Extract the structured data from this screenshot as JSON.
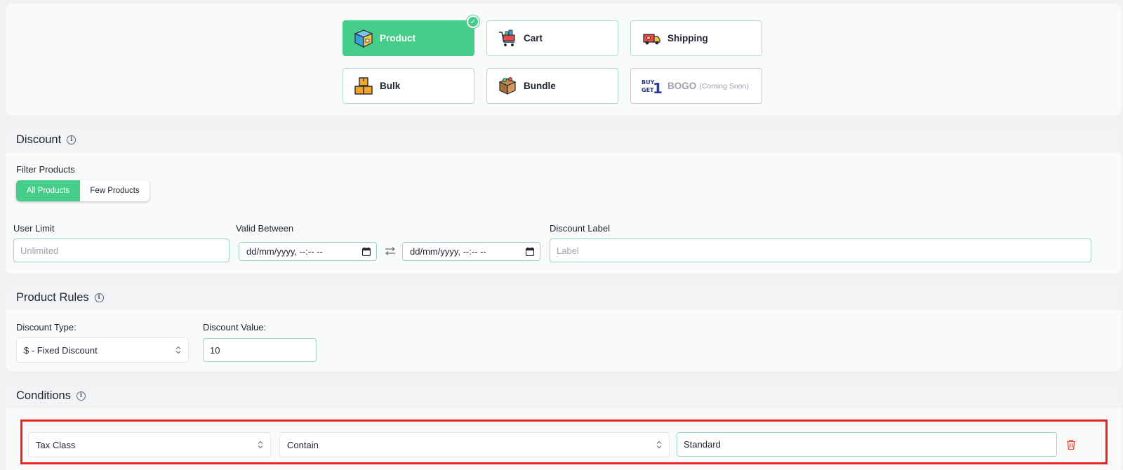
{
  "campaign_types": [
    {
      "label": "Product",
      "icon": "product-box-icon",
      "active": true
    },
    {
      "label": "Cart",
      "icon": "cart-icon"
    },
    {
      "label": "Shipping",
      "icon": "shipping-truck-icon"
    },
    {
      "label": "Bulk",
      "icon": "bulk-boxes-icon"
    },
    {
      "label": "Bundle",
      "icon": "bundle-box-icon"
    },
    {
      "label": "BOGO",
      "note": "(Coming Soon)",
      "icon": "buy-get-1-icon",
      "disabled": true
    }
  ],
  "bogo_icon_text": {
    "line1": "BUY",
    "line2": "GET",
    "digit": "1"
  },
  "discount": {
    "title": "Discount",
    "filter_label": "Filter Products",
    "filter_options": [
      "All Products",
      "Few Products"
    ],
    "user_limit_label": "User Limit",
    "user_limit_placeholder": "Unlimited",
    "valid_between_label": "Valid Between",
    "date_placeholder": "dd/mm/yyyy, --:-- --",
    "discount_label_label": "Discount Label",
    "discount_label_placeholder": "Label"
  },
  "product_rules": {
    "title": "Product Rules",
    "type_label": "Discount Type:",
    "type_value": "$ - Fixed Discount",
    "value_label": "Discount Value:",
    "value": "10"
  },
  "conditions": {
    "title": "Conditions",
    "rows": [
      {
        "field": "Tax Class",
        "operator": "Contain",
        "value": "Standard"
      }
    ]
  },
  "colors": {
    "accent": "#46cd89",
    "highlight_border": "#e8231d",
    "delete": "#e2483d"
  }
}
